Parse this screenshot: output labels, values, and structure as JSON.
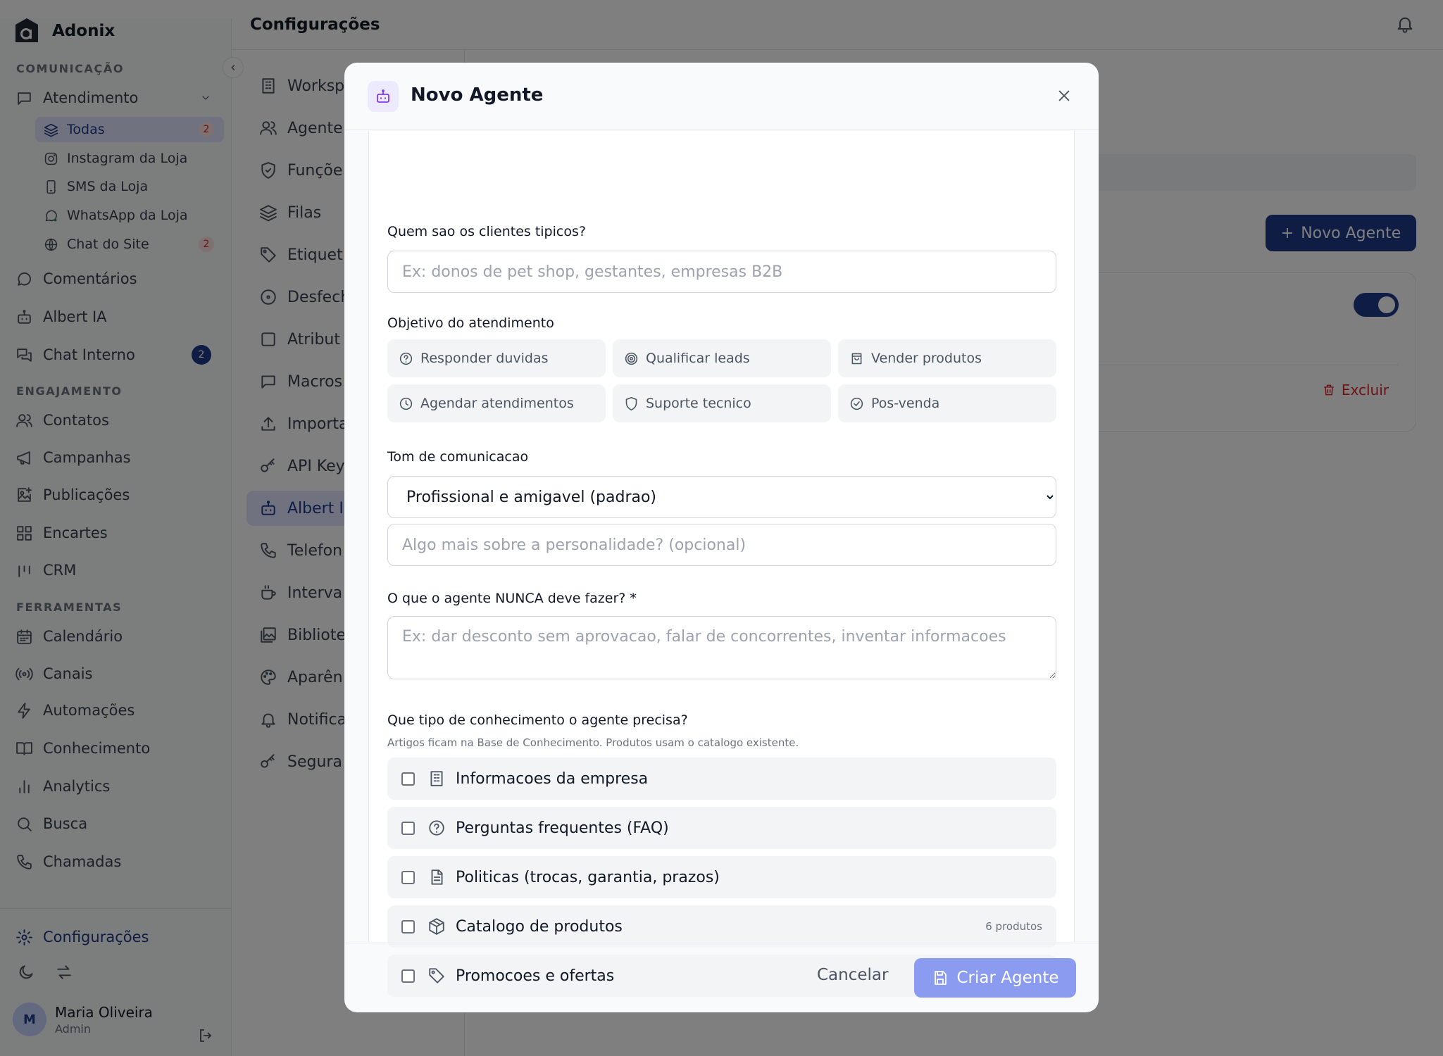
{
  "app": {
    "name": "Adonix"
  },
  "sidebar": {
    "sections": {
      "comunicacao": "COMUNICAÇÃO",
      "engajamento": "ENGAJAMENTO",
      "ferramentas": "FERRAMENTAS"
    },
    "atendimento": {
      "label": "Atendimento"
    },
    "inboxes": [
      {
        "label": "Todas",
        "badge": "2",
        "icon": "layers-icon"
      },
      {
        "label": "Instagram da Loja",
        "badge": "",
        "icon": "instagram-icon"
      },
      {
        "label": "SMS da Loja",
        "badge": "",
        "icon": "phone-device-icon"
      },
      {
        "label": "WhatsApp da Loja",
        "badge": "",
        "icon": "whatsapp-icon"
      },
      {
        "label": "Chat do Site",
        "badge": "2",
        "icon": "globe-icon"
      }
    ],
    "comunicacao_items": [
      {
        "label": "Comentários",
        "icon": "comment-icon"
      },
      {
        "label": "Albert IA",
        "icon": "bot-icon"
      },
      {
        "label": "Chat Interno",
        "badge": "2",
        "icon": "chat-icon"
      }
    ],
    "engajamento_items": [
      {
        "label": "Contatos",
        "icon": "users-icon"
      },
      {
        "label": "Campanhas",
        "icon": "megaphone-icon"
      },
      {
        "label": "Publicações",
        "icon": "image-plus-icon"
      },
      {
        "label": "Encartes",
        "icon": "grid-icon"
      },
      {
        "label": "CRM",
        "icon": "kanban-icon"
      }
    ],
    "ferramentas_items": [
      {
        "label": "Calendário",
        "icon": "calendar-icon"
      },
      {
        "label": "Canais",
        "icon": "radio-icon"
      },
      {
        "label": "Automações",
        "icon": "zap-icon"
      },
      {
        "label": "Conhecimento",
        "icon": "book-icon"
      },
      {
        "label": "Analytics",
        "icon": "bar-chart-icon"
      },
      {
        "label": "Busca",
        "icon": "search-icon"
      },
      {
        "label": "Chamadas",
        "icon": "phone-icon"
      }
    ],
    "settings_label": "Configurações",
    "user": {
      "initial": "M",
      "name": "Maria Oliveira",
      "role": "Admin"
    }
  },
  "header": {
    "title": "Configurações"
  },
  "settings_nav": [
    {
      "label": "Worksp",
      "icon": "building-icon"
    },
    {
      "label": "Agente",
      "icon": "users-icon"
    },
    {
      "label": "Funçõe",
      "icon": "shield-icon"
    },
    {
      "label": "Filas",
      "icon": "layers-icon"
    },
    {
      "label": "Etiquet",
      "icon": "tag-icon"
    },
    {
      "label": "Desfech",
      "icon": "circle-dot-icon"
    },
    {
      "label": "Atribut",
      "icon": "square-icon"
    },
    {
      "label": "Macros",
      "icon": "message-square-icon"
    },
    {
      "label": "Importa",
      "icon": "upload-icon"
    },
    {
      "label": "API Key",
      "icon": "key-icon"
    },
    {
      "label": "Albert I",
      "icon": "bot-icon",
      "active": true
    },
    {
      "label": "Telefon",
      "icon": "phone-icon"
    },
    {
      "label": "Interva",
      "icon": "coffee-icon"
    },
    {
      "label": "Bibliote",
      "icon": "image-library-icon"
    },
    {
      "label": "Aparên",
      "icon": "palette-icon"
    },
    {
      "label": "Notifica",
      "icon": "bell-icon"
    },
    {
      "label": "Segura",
      "icon": "key-icon"
    }
  ],
  "content": {
    "new_agent_label": "Novo Agente",
    "delete_label": "Excluir",
    "agent_enabled": true
  },
  "modal": {
    "title": "Novo Agente",
    "clients": {
      "label": "Quem sao os clientes tipicos?",
      "placeholder": "Ex: donos de pet shop, gestantes, empresas B2B",
      "value": ""
    },
    "objective": {
      "label": "Objetivo do atendimento",
      "options": [
        {
          "label": "Responder duvidas",
          "icon": "help-circle-icon"
        },
        {
          "label": "Qualificar leads",
          "icon": "target-icon"
        },
        {
          "label": "Vender produtos",
          "icon": "shopping-bag-icon"
        },
        {
          "label": "Agendar atendimentos",
          "icon": "clock-icon"
        },
        {
          "label": "Suporte tecnico",
          "icon": "shield-icon"
        },
        {
          "label": "Pos-venda",
          "icon": "check-circle-icon"
        }
      ]
    },
    "tone": {
      "label": "Tom de comunicacao",
      "selected": "Profissional e amigavel (padrao)",
      "personality_placeholder": "Algo mais sobre a personalidade? (opcional)"
    },
    "never": {
      "label": "O que o agente NUNCA deve fazer? *",
      "placeholder": "Ex: dar desconto sem aprovacao, falar de concorrentes, inventar informacoes"
    },
    "knowledge": {
      "label": "Que tipo de conhecimento o agente precisa?",
      "hint": "Artigos ficam na Base de Conhecimento. Produtos usam o catalogo existente.",
      "items": [
        {
          "label": "Informacoes da empresa",
          "icon": "building-icon",
          "count": ""
        },
        {
          "label": "Perguntas frequentes (FAQ)",
          "icon": "help-circle-icon",
          "count": ""
        },
        {
          "label": "Politicas (trocas, garantia, prazos)",
          "icon": "file-text-icon",
          "count": ""
        },
        {
          "label": "Catalogo de produtos",
          "icon": "package-icon",
          "count": "6 produtos"
        },
        {
          "label": "Promocoes e ofertas",
          "icon": "tag-icon",
          "count": ""
        }
      ]
    },
    "footer": {
      "cancel_label": "Cancelar",
      "create_label": "Criar Agente"
    }
  }
}
